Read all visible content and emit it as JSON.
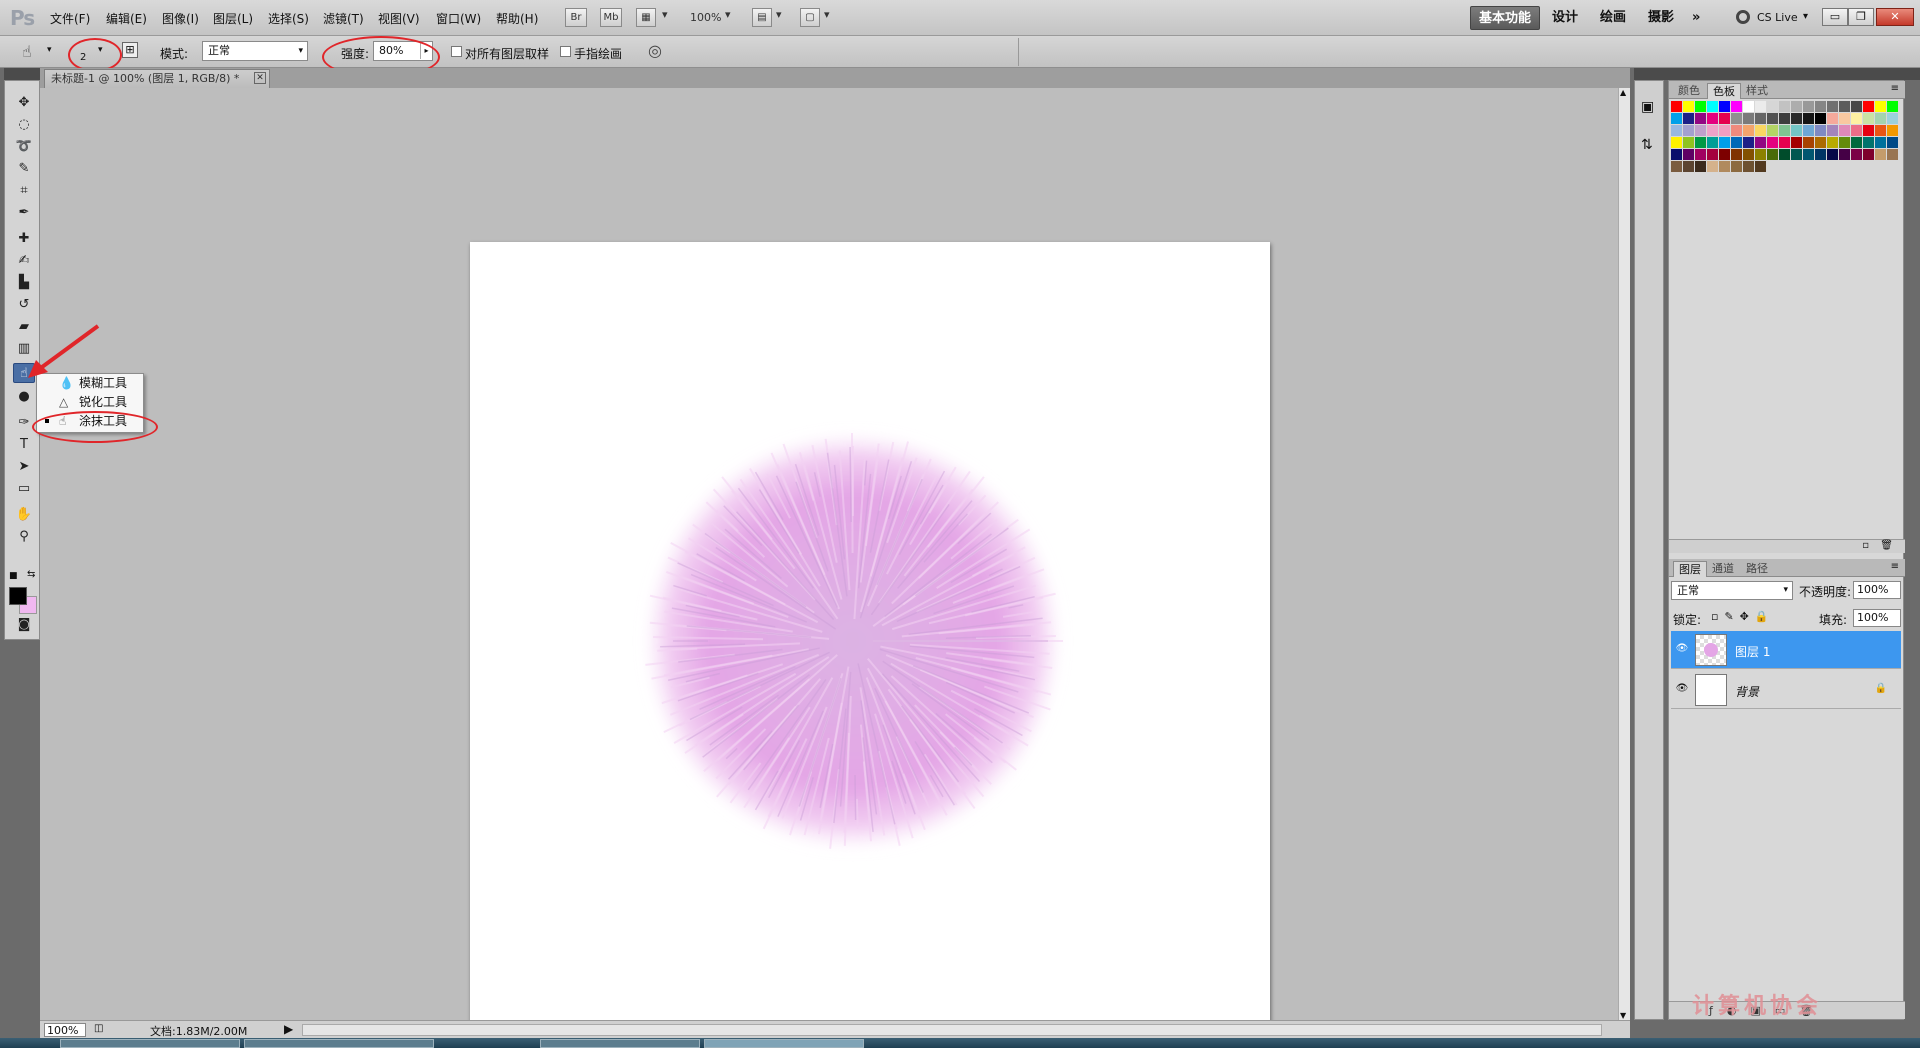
{
  "app": {
    "logo": "Ps"
  },
  "menu": [
    "文件(F)",
    "编辑(E)",
    "图像(I)",
    "图层(L)",
    "选择(S)",
    "滤镜(T)",
    "视图(V)",
    "窗口(W)",
    "帮助(H)"
  ],
  "appbar": {
    "br": "Br",
    "mb": "Mb",
    "zoom": "100%"
  },
  "workspaces": [
    "基本功能",
    "设计",
    "绘画",
    "摄影"
  ],
  "workspace_more": "»",
  "cs_live": "CS Live",
  "options": {
    "brush_size": "2",
    "mode_label": "模式:",
    "mode_value": "正常",
    "strength_label": "强度:",
    "strength_value": "80%",
    "sample_all_label": "对所有图层取样",
    "finger_paint_label": "手指绘画"
  },
  "document": {
    "tab_title": "未标题-1 @ 100% (图层 1, RGB/8) *",
    "zoom": "100%",
    "doc_size": "文档:1.83M/2.00M"
  },
  "flyout": [
    {
      "icon": "blur-icon",
      "label": "模糊工具",
      "selected": false
    },
    {
      "icon": "sharpen-icon",
      "label": "锐化工具",
      "selected": false
    },
    {
      "icon": "smudge-icon",
      "label": "涂抹工具",
      "selected": true
    }
  ],
  "panels": {
    "color_tabs": [
      "颜色",
      "色板",
      "样式"
    ],
    "color_active": "色板",
    "layers_tabs": [
      "图层",
      "通道",
      "路径"
    ],
    "layers_active": "图层",
    "blend_mode": "正常",
    "opacity_label": "不透明度:",
    "opacity_value": "100%",
    "lock_label": "锁定:",
    "fill_label": "填充:",
    "fill_value": "100%",
    "layers": [
      {
        "name": "图层 1",
        "selected": true
      },
      {
        "name": "背景",
        "selected": false,
        "locked": true
      }
    ]
  },
  "colors": {
    "foreground": "#000000",
    "background": "#f0b8f0",
    "selection": "#3d97ef",
    "annotation": "#e0262a"
  },
  "swatches": [
    "#ff0000",
    "#ffff00",
    "#00ff00",
    "#00ffff",
    "#0000ff",
    "#ff00ff",
    "#ffffff",
    "#ebebeb",
    "#d6d6d6",
    "#c2c2c2",
    "#adadad",
    "#999999",
    "#858585",
    "#707070",
    "#5c5c5c",
    "#474747",
    "#ff0000",
    "#ffff00",
    "#00ff00",
    "#00a0e9",
    "#1d2088",
    "#920783",
    "#e4007f",
    "#e5004f",
    "#8f8f8f",
    "#7a7a7a",
    "#666666",
    "#525252",
    "#3d3d3d",
    "#292929",
    "#141414",
    "#000000",
    "#f5a99b",
    "#f9c8a0",
    "#fef1a2",
    "#c9e2a4",
    "#a3d4ae",
    "#9cd1dc",
    "#99b8e0",
    "#a3a0cf",
    "#c0a0cc",
    "#efa3c9",
    "#f19ec2",
    "#f08a7d",
    "#f3a46c",
    "#fad763",
    "#b3d465",
    "#7fc391",
    "#73c5c5",
    "#6ea7d4",
    "#7f8ac4",
    "#a385bc",
    "#e089b8",
    "#ec6d87",
    "#e60012",
    "#ea5514",
    "#f39800",
    "#fff100",
    "#8fc31f",
    "#009944",
    "#009e96",
    "#00a0e9",
    "#0068b7",
    "#1d2088",
    "#920783",
    "#e4007f",
    "#e5004f",
    "#a40000",
    "#a84200",
    "#ac6a00",
    "#b7aa00",
    "#638c0b",
    "#00693e",
    "#00736d",
    "#00719c",
    "#004986",
    "#0a0e6b",
    "#5f0064",
    "#a00061",
    "#a4003e",
    "#7d0000",
    "#803200",
    "#835100",
    "#8c8100",
    "#4a6b08",
    "#004c2b",
    "#005751",
    "#005670",
    "#003564",
    "#070948",
    "#450046",
    "#7b0046",
    "#7e002c",
    "#c49c6b",
    "#997552",
    "#7a5c3f",
    "#5c4430",
    "#3b2a1c",
    "#d5b28c",
    "#b08a5e",
    "#8c6a40",
    "#6e5131",
    "#52391f"
  ],
  "watermark": "计算机协会"
}
